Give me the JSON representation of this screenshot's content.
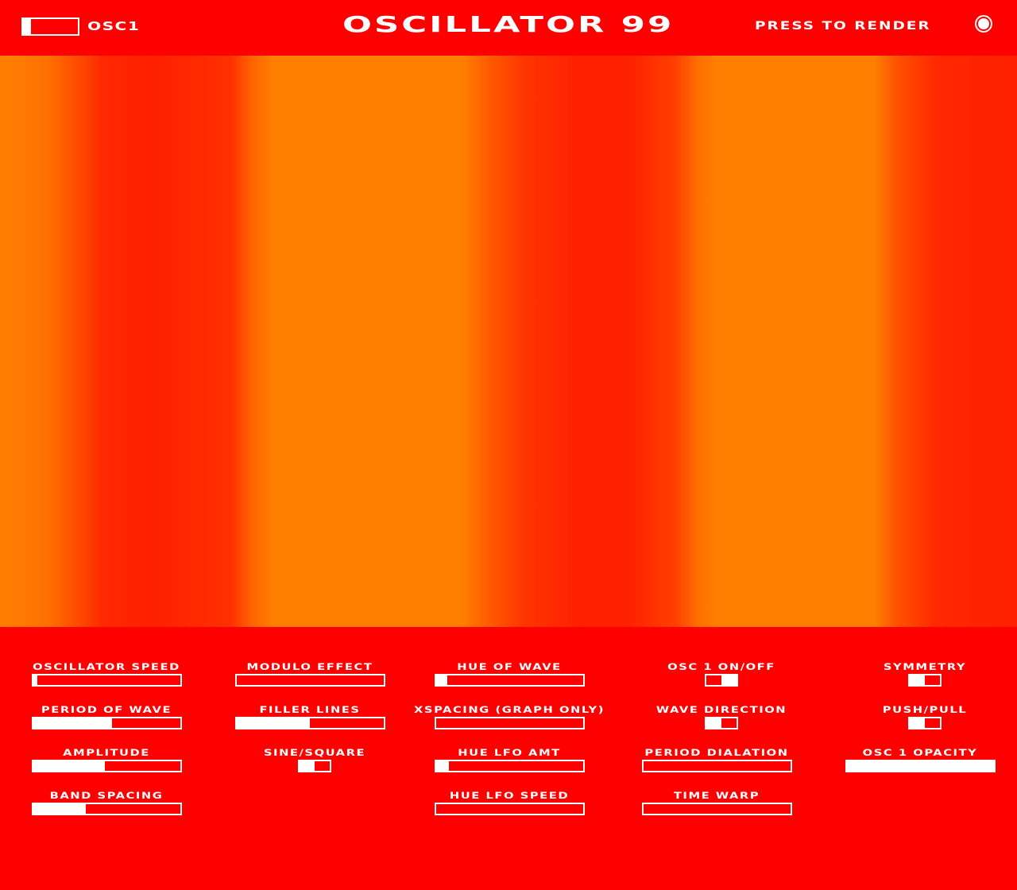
{
  "header": {
    "tab_label": "OSC1",
    "tab_level": 0.15,
    "title": "OSCILLATOR 99",
    "render_label": "PRESS TO RENDER"
  },
  "colors": {
    "background": "#ff0000",
    "foreground": "#ffffff",
    "wave_light": "#ff8000",
    "wave_dark": "#ff2000"
  },
  "controls": {
    "osc_speed": {
      "label": "OSCILLATOR SPEED",
      "value": 0.03
    },
    "period_of_wave": {
      "label": "PERIOD OF WAVE",
      "value": 0.54
    },
    "amplitude": {
      "label": "AMPLITUDE",
      "value": 0.49
    },
    "band_spacing": {
      "label": "BAND SPACING",
      "value": 0.36
    },
    "modulo_effect": {
      "label": "MODULO EFFECT",
      "value": 0.0
    },
    "filler_lines": {
      "label": "FILLER LINES",
      "value": 0.5
    },
    "sine_square": {
      "label": "SINE/SQUARE",
      "state": "off"
    },
    "hue_of_wave": {
      "label": "HUE OF WAVE",
      "value": 0.08
    },
    "xspacing": {
      "label": "XSPACING (GRAPH ONLY)",
      "value": 0.0
    },
    "hue_lfo_amt": {
      "label": "HUE LFO AMT",
      "value": 0.09
    },
    "hue_lfo_speed": {
      "label": "HUE LFO SPEED",
      "value": 0.0
    },
    "osc1_on_off": {
      "label": "OSC 1 ON/OFF",
      "state": "on"
    },
    "wave_direction": {
      "label": "WAVE DIRECTION",
      "state": "off"
    },
    "period_dialation": {
      "label": "PERIOD DIALATION",
      "value": 0.0
    },
    "time_warp": {
      "label": "TIME WARP",
      "value": 0.0
    },
    "symmetry": {
      "label": "SYMMETRY",
      "state": "off"
    },
    "push_pull": {
      "label": "PUSH/PULL",
      "state": "off"
    },
    "osc1_opacity": {
      "label": "OSC 1 OPACITY",
      "value": 1.0
    }
  }
}
